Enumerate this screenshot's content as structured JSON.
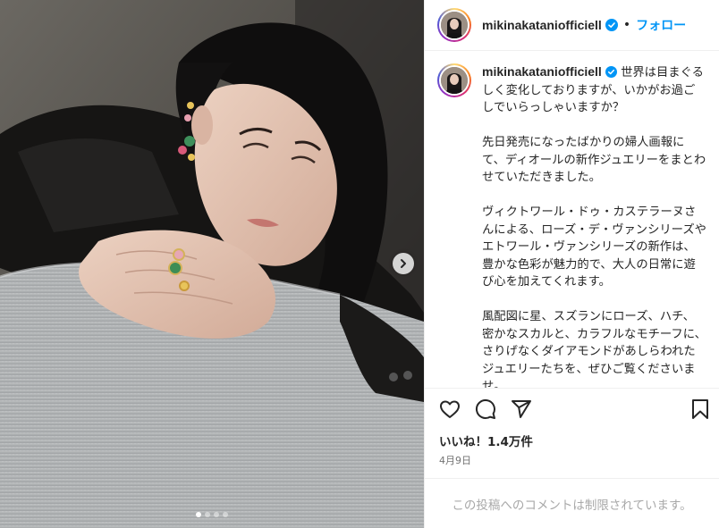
{
  "post": {
    "username": "mikinakataniofficiell",
    "verified_icon": "verified-badge-icon",
    "separator": "•",
    "follow_label": "フォロー",
    "caption": "世界は目まぐるしく変化しておりますが、いかがお過ごしでいらっしゃいますか？\n\n先日発売になったばかりの婦人画報にて、ディオールの新作ジュエリーをまとわせていただきました。\n\nヴィクトワール・ドゥ・カステラーヌさんによる、ローズ・デ・ヴァンシリーズやエトワール・ヴァンシリーズの新作は、豊かな色彩が魅力的で、大人の日常に遊び心を加えてくれます。\n\n風配図に星、スズランにローズ、ハチ、密かなスカルと、カラフルなモチーフに、さりげなくダイアモンドがあしらわれたジュエリーたちを、ぜひご覧くださいませ。",
    "likes": "いいね！1.4万件",
    "date": "4月9日",
    "comments_disabled": "この投稿へのコメントは制限されています。"
  },
  "icons": {
    "like": "heart-icon",
    "comment": "comment-icon",
    "share": "share-icon",
    "save": "bookmark-icon",
    "next": "chevron-right-icon"
  },
  "colors": {
    "follow": "#0095f6",
    "verified": "#0095f6",
    "text": "#262626",
    "muted": "#737373",
    "disabled": "#a8a8a8"
  },
  "carousel": {
    "slides": 4,
    "active_index": 0
  }
}
